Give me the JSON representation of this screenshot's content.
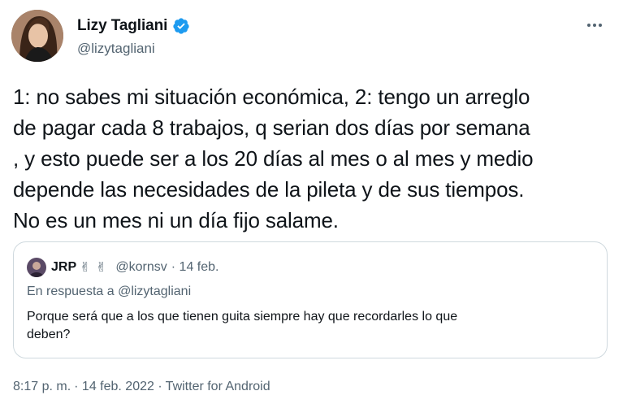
{
  "author": {
    "display_name": "Lizy Tagliani",
    "handle": "@lizytagliani",
    "verified": true
  },
  "tweet": {
    "text": "1: no sabes mi situación económica, 2: tengo un arreglo\nde pagar cada 8 trabajos, q serian dos días por semana\n, y esto puede ser a los 20 días al mes o al mes y medio\ndepende las necesidades de la pileta y de sus tiempos.\nNo es un mes ni un día fijo salame."
  },
  "quote": {
    "name": "JRP",
    "emoji": "✌ ✌",
    "handle": "@kornsv",
    "date": "· 14 feb.",
    "reply_prefix": "En respuesta a",
    "reply_mention": "@lizytagliani",
    "text": "Porque será que a los que tienen guita siempre hay que recordarles lo que\ndeben?"
  },
  "meta": {
    "time": "8:17 p. m.",
    "date": "· 14 feb. 2022 ·",
    "source": "Twitter for Android"
  },
  "colors": {
    "verified": "#1d9bf0",
    "secondary_text": "#536471",
    "border": "#cfd9de"
  },
  "icons": {
    "verified": "verified-badge-icon",
    "more": "more-dots-icon"
  }
}
